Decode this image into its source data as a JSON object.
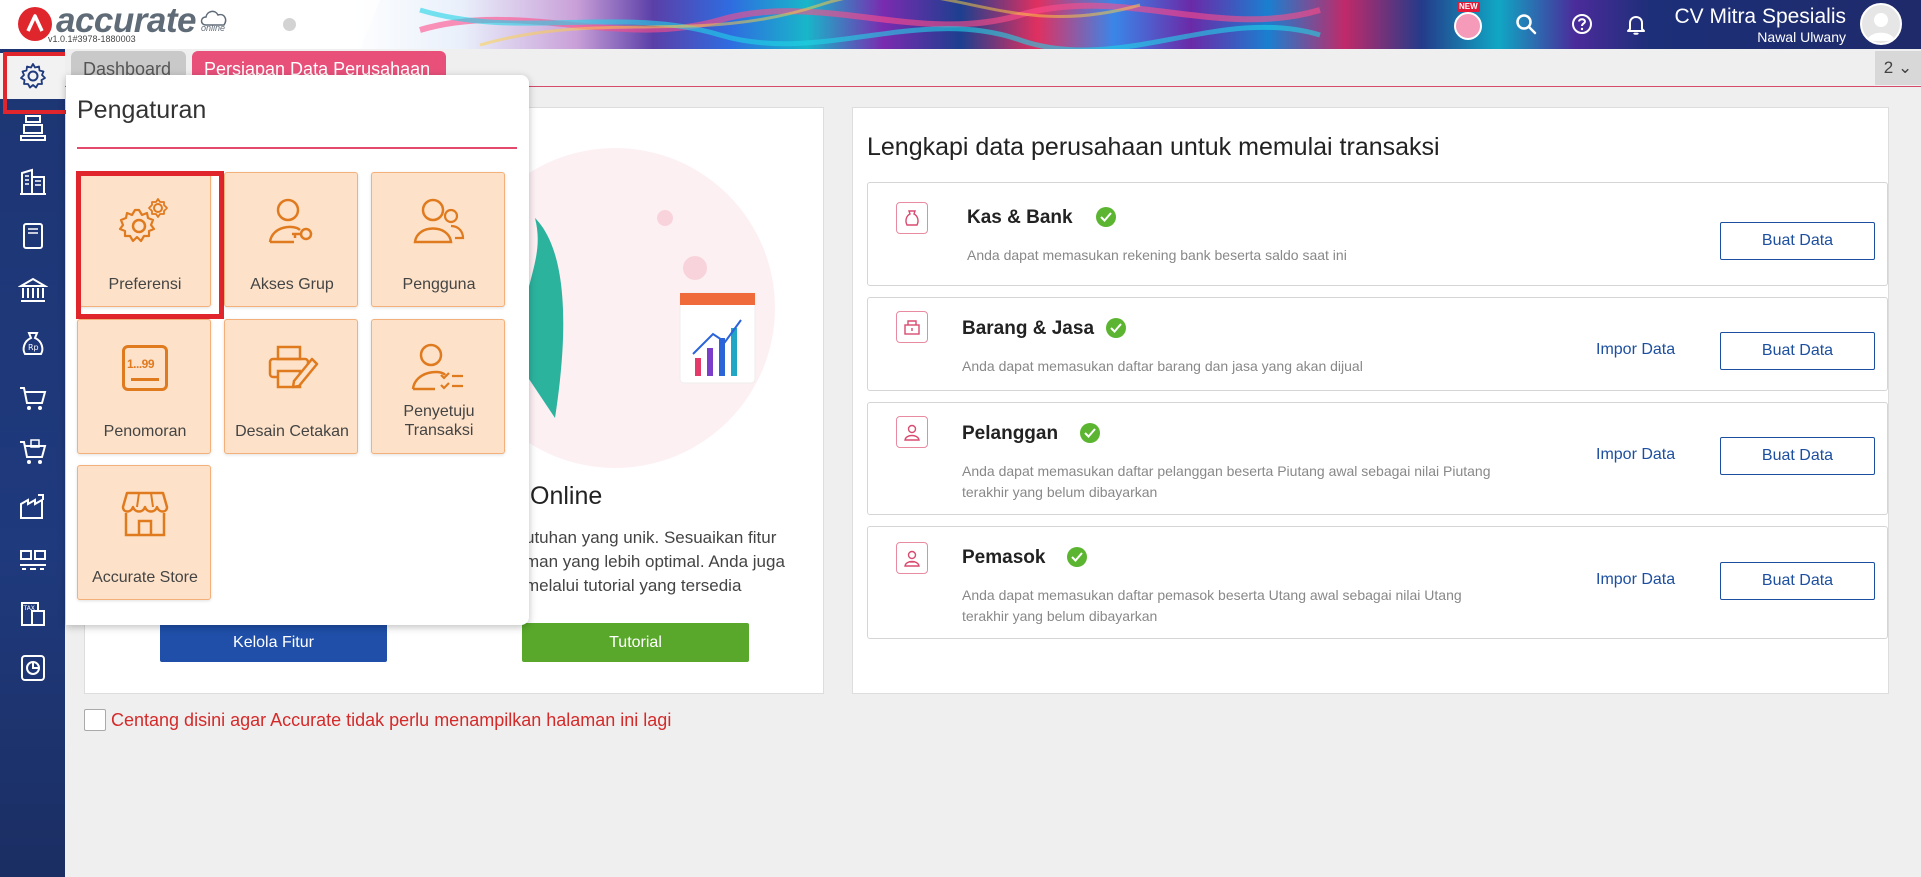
{
  "header": {
    "logo_text": "accurate",
    "logo_sub": "online",
    "version": "v1.0.1#3978-1880003",
    "new_badge": "NEW",
    "company_name": "CV Mitra Spesialis",
    "user_name": "Nawal Ulwany"
  },
  "sidebar": {
    "items": [
      {
        "icon": "gear-icon"
      },
      {
        "icon": "store-icon"
      },
      {
        "icon": "building-icon"
      },
      {
        "icon": "ledger-icon"
      },
      {
        "icon": "bank-icon"
      },
      {
        "icon": "money-bag-icon"
      },
      {
        "icon": "cart-icon"
      },
      {
        "icon": "purchase-cart-icon"
      },
      {
        "icon": "factory-icon"
      },
      {
        "icon": "inventory-icon"
      },
      {
        "icon": "tax-icon"
      },
      {
        "icon": "report-chart-icon"
      }
    ]
  },
  "tabs": {
    "dashboard": "Dashboard",
    "prep": "Persiapan Data Perusahaan",
    "count": "2"
  },
  "left_card": {
    "heading": "rate Online",
    "desc_lines": [
      "utuhan yang unik. Sesuaikan fitur",
      "man yang lebih optimal. Anda juga",
      "melalui tutorial yang tersedia"
    ],
    "btn_fitur": "Kelola Fitur",
    "btn_tutorial": "Tutorial"
  },
  "checkbox_label": "Centang disini agar Accurate tidak perlu menampilkan halaman ini lagi",
  "right_card": {
    "title": "Lengkapi data perusahaan untuk memulai transaksi",
    "rows": [
      {
        "title": "Kas & Bank",
        "desc1": "Anda dapat memasukan rekening bank beserta saldo saat ini",
        "desc2": "",
        "impor": "",
        "buat": "Buat Data"
      },
      {
        "title": "Barang & Jasa",
        "desc1": "Anda dapat memasukan daftar barang dan jasa yang akan dijual",
        "desc2": "",
        "impor": "Impor Data",
        "buat": "Buat Data"
      },
      {
        "title": "Pelanggan",
        "desc1": "Anda dapat memasukan daftar pelanggan beserta Piutang awal sebagai nilai Piutang",
        "desc2": "terakhir yang belum dibayarkan",
        "impor": "Impor Data",
        "buat": "Buat Data"
      },
      {
        "title": "Pemasok",
        "desc1": "Anda dapat memasukan daftar pemasok beserta Utang awal sebagai nilai Utang",
        "desc2": "terakhir yang belum dibayarkan",
        "impor": "Impor Data",
        "buat": "Buat Data"
      }
    ]
  },
  "panel": {
    "title": "Pengaturan",
    "tiles": [
      {
        "label": "Preferensi",
        "icon": "gears-icon"
      },
      {
        "label": "Akses Grup",
        "icon": "user-key-icon"
      },
      {
        "label": "Pengguna",
        "icon": "users-icon"
      },
      {
        "label": "Penomoran",
        "icon": "numbering-icon",
        "icon_text": "1...99"
      },
      {
        "label": "Desain Cetakan",
        "icon": "printer-design-icon"
      },
      {
        "label": "Penyetuju Transaksi",
        "icon": "user-approve-icon",
        "label_line1": "Penyetuju",
        "label_line2": "Transaksi"
      },
      {
        "label": "Accurate Store",
        "icon": "shop-icon"
      }
    ]
  },
  "colors": {
    "sidebar": "#1f3a7d",
    "accent_pink": "#e8507a",
    "tile_bg": "#fde2c9",
    "tile_icon": "#e07a1f",
    "link_blue": "#1d4fa0",
    "check_green": "#5bb531"
  }
}
